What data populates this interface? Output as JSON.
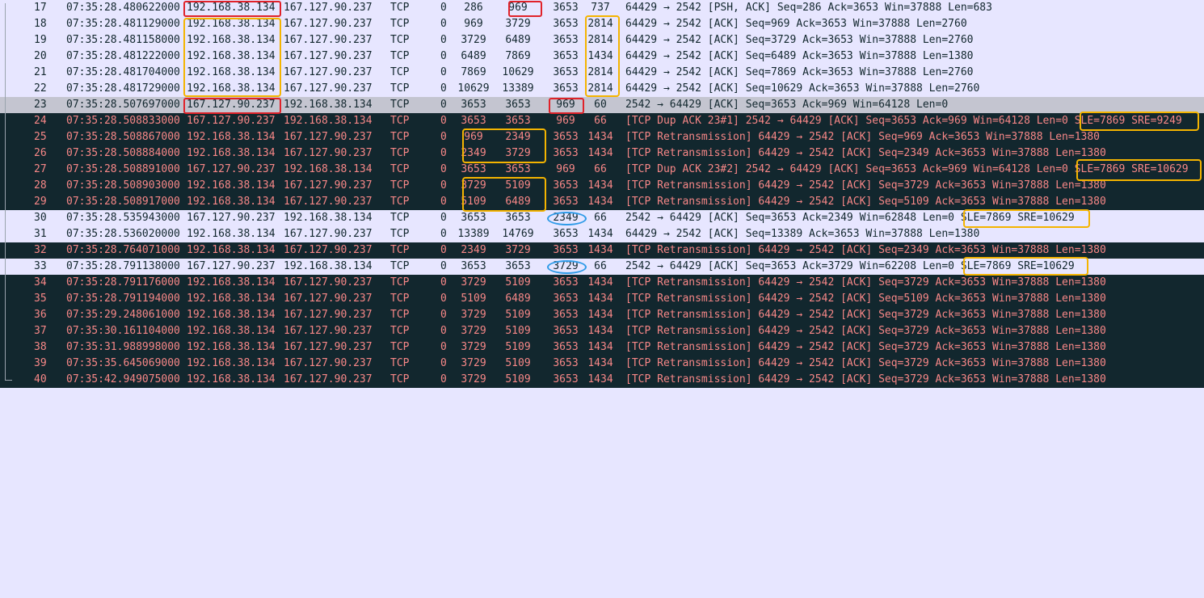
{
  "packets": [
    {
      "no": "17",
      "time": "07:35:28.480622000",
      "src": "192.168.38.134",
      "dst": "167.127.90.237",
      "proto": "TCP",
      "z": "0",
      "seq": "286",
      "nseq": "969",
      "ack": "3653",
      "len": "737",
      "info": "64429 → 2542 [PSH, ACK] Seq=286 Ack=3653 Win=37888 Len=683",
      "style": "tcp"
    },
    {
      "no": "18",
      "time": "07:35:28.481129000",
      "src": "192.168.38.134",
      "dst": "167.127.90.237",
      "proto": "TCP",
      "z": "0",
      "seq": "969",
      "nseq": "3729",
      "ack": "3653",
      "len": "2814",
      "info": "64429 → 2542 [ACK] Seq=969 Ack=3653 Win=37888 Len=2760",
      "style": "tcp"
    },
    {
      "no": "19",
      "time": "07:35:28.481158000",
      "src": "192.168.38.134",
      "dst": "167.127.90.237",
      "proto": "TCP",
      "z": "0",
      "seq": "3729",
      "nseq": "6489",
      "ack": "3653",
      "len": "2814",
      "info": "64429 → 2542 [ACK] Seq=3729 Ack=3653 Win=37888 Len=2760",
      "style": "tcp"
    },
    {
      "no": "20",
      "time": "07:35:28.481222000",
      "src": "192.168.38.134",
      "dst": "167.127.90.237",
      "proto": "TCP",
      "z": "0",
      "seq": "6489",
      "nseq": "7869",
      "ack": "3653",
      "len": "1434",
      "info": "64429 → 2542 [ACK] Seq=6489 Ack=3653 Win=37888 Len=1380",
      "style": "tcp"
    },
    {
      "no": "21",
      "time": "07:35:28.481704000",
      "src": "192.168.38.134",
      "dst": "167.127.90.237",
      "proto": "TCP",
      "z": "0",
      "seq": "7869",
      "nseq": "10629",
      "ack": "3653",
      "len": "2814",
      "info": "64429 → 2542 [ACK] Seq=7869 Ack=3653 Win=37888 Len=2760",
      "style": "tcp"
    },
    {
      "no": "22",
      "time": "07:35:28.481729000",
      "src": "192.168.38.134",
      "dst": "167.127.90.237",
      "proto": "TCP",
      "z": "0",
      "seq": "10629",
      "nseq": "13389",
      "ack": "3653",
      "len": "2814",
      "info": "64429 → 2542 [ACK] Seq=10629 Ack=3653 Win=37888 Len=2760",
      "style": "tcp"
    },
    {
      "no": "23",
      "time": "07:35:28.507697000",
      "src": "167.127.90.237",
      "dst": "192.168.38.134",
      "proto": "TCP",
      "z": "0",
      "seq": "3653",
      "nseq": "3653",
      "ack": "969",
      "len": "60",
      "info": "2542 → 64429 [ACK] Seq=3653 Ack=969 Win=64128 Len=0",
      "style": "sel"
    },
    {
      "no": "24",
      "time": "07:35:28.508833000",
      "src": "167.127.90.237",
      "dst": "192.168.38.134",
      "proto": "TCP",
      "z": "0",
      "seq": "3653",
      "nseq": "3653",
      "ack": "969",
      "len": "66",
      "info": "[TCP Dup ACK 23#1] 2542 → 64429 [ACK] Seq=3653 Ack=969 Win=64128 Len=0 SLE=7869 SRE=9249",
      "style": "bad"
    },
    {
      "no": "25",
      "time": "07:35:28.508867000",
      "src": "192.168.38.134",
      "dst": "167.127.90.237",
      "proto": "TCP",
      "z": "0",
      "seq": "969",
      "nseq": "2349",
      "ack": "3653",
      "len": "1434",
      "info": "[TCP Retransmission] 64429 → 2542 [ACK] Seq=969 Ack=3653 Win=37888 Len=1380",
      "style": "bad"
    },
    {
      "no": "26",
      "time": "07:35:28.508884000",
      "src": "192.168.38.134",
      "dst": "167.127.90.237",
      "proto": "TCP",
      "z": "0",
      "seq": "2349",
      "nseq": "3729",
      "ack": "3653",
      "len": "1434",
      "info": "[TCP Retransmission] 64429 → 2542 [ACK] Seq=2349 Ack=3653 Win=37888 Len=1380",
      "style": "bad"
    },
    {
      "no": "27",
      "time": "07:35:28.508891000",
      "src": "167.127.90.237",
      "dst": "192.168.38.134",
      "proto": "TCP",
      "z": "0",
      "seq": "3653",
      "nseq": "3653",
      "ack": "969",
      "len": "66",
      "info": "[TCP Dup ACK 23#2] 2542 → 64429 [ACK] Seq=3653 Ack=969 Win=64128 Len=0 SLE=7869 SRE=10629",
      "style": "bad"
    },
    {
      "no": "28",
      "time": "07:35:28.508903000",
      "src": "192.168.38.134",
      "dst": "167.127.90.237",
      "proto": "TCP",
      "z": "0",
      "seq": "3729",
      "nseq": "5109",
      "ack": "3653",
      "len": "1434",
      "info": "[TCP Retransmission] 64429 → 2542 [ACK] Seq=3729 Ack=3653 Win=37888 Len=1380",
      "style": "bad"
    },
    {
      "no": "29",
      "time": "07:35:28.508917000",
      "src": "192.168.38.134",
      "dst": "167.127.90.237",
      "proto": "TCP",
      "z": "0",
      "seq": "5109",
      "nseq": "6489",
      "ack": "3653",
      "len": "1434",
      "info": "[TCP Retransmission] 64429 → 2542 [ACK] Seq=5109 Ack=3653 Win=37888 Len=1380",
      "style": "bad"
    },
    {
      "no": "30",
      "time": "07:35:28.535943000",
      "src": "167.127.90.237",
      "dst": "192.168.38.134",
      "proto": "TCP",
      "z": "0",
      "seq": "3653",
      "nseq": "3653",
      "ack": "2349",
      "len": "66",
      "info": "2542 → 64429 [ACK] Seq=3653 Ack=2349 Win=62848 Len=0 SLE=7869 SRE=10629",
      "style": "tcp"
    },
    {
      "no": "31",
      "time": "07:35:28.536020000",
      "src": "192.168.38.134",
      "dst": "167.127.90.237",
      "proto": "TCP",
      "z": "0",
      "seq": "13389",
      "nseq": "14769",
      "ack": "3653",
      "len": "1434",
      "info": "64429 → 2542 [ACK] Seq=13389 Ack=3653 Win=37888 Len=1380",
      "style": "tcp"
    },
    {
      "no": "32",
      "time": "07:35:28.764071000",
      "src": "192.168.38.134",
      "dst": "167.127.90.237",
      "proto": "TCP",
      "z": "0",
      "seq": "2349",
      "nseq": "3729",
      "ack": "3653",
      "len": "1434",
      "info": "[TCP Retransmission] 64429 → 2542 [ACK] Seq=2349 Ack=3653 Win=37888 Len=1380",
      "style": "bad"
    },
    {
      "no": "33",
      "time": "07:35:28.791138000",
      "src": "167.127.90.237",
      "dst": "192.168.38.134",
      "proto": "TCP",
      "z": "0",
      "seq": "3653",
      "nseq": "3653",
      "ack": "3729",
      "len": "66",
      "info": "2542 → 64429 [ACK] Seq=3653 Ack=3729 Win=62208 Len=0 SLE=7869 SRE=10629",
      "style": "tcp"
    },
    {
      "no": "34",
      "time": "07:35:28.791176000",
      "src": "192.168.38.134",
      "dst": "167.127.90.237",
      "proto": "TCP",
      "z": "0",
      "seq": "3729",
      "nseq": "5109",
      "ack": "3653",
      "len": "1434",
      "info": "[TCP Retransmission] 64429 → 2542 [ACK] Seq=3729 Ack=3653 Win=37888 Len=1380",
      "style": "bad"
    },
    {
      "no": "35",
      "time": "07:35:28.791194000",
      "src": "192.168.38.134",
      "dst": "167.127.90.237",
      "proto": "TCP",
      "z": "0",
      "seq": "5109",
      "nseq": "6489",
      "ack": "3653",
      "len": "1434",
      "info": "[TCP Retransmission] 64429 → 2542 [ACK] Seq=5109 Ack=3653 Win=37888 Len=1380",
      "style": "bad"
    },
    {
      "no": "36",
      "time": "07:35:29.248061000",
      "src": "192.168.38.134",
      "dst": "167.127.90.237",
      "proto": "TCP",
      "z": "0",
      "seq": "3729",
      "nseq": "5109",
      "ack": "3653",
      "len": "1434",
      "info": "[TCP Retransmission] 64429 → 2542 [ACK] Seq=3729 Ack=3653 Win=37888 Len=1380",
      "style": "bad"
    },
    {
      "no": "37",
      "time": "07:35:30.161104000",
      "src": "192.168.38.134",
      "dst": "167.127.90.237",
      "proto": "TCP",
      "z": "0",
      "seq": "3729",
      "nseq": "5109",
      "ack": "3653",
      "len": "1434",
      "info": "[TCP Retransmission] 64429 → 2542 [ACK] Seq=3729 Ack=3653 Win=37888 Len=1380",
      "style": "bad"
    },
    {
      "no": "38",
      "time": "07:35:31.988998000",
      "src": "192.168.38.134",
      "dst": "167.127.90.237",
      "proto": "TCP",
      "z": "0",
      "seq": "3729",
      "nseq": "5109",
      "ack": "3653",
      "len": "1434",
      "info": "[TCP Retransmission] 64429 → 2542 [ACK] Seq=3729 Ack=3653 Win=37888 Len=1380",
      "style": "bad"
    },
    {
      "no": "39",
      "time": "07:35:35.645069000",
      "src": "192.168.38.134",
      "dst": "167.127.90.237",
      "proto": "TCP",
      "z": "0",
      "seq": "3729",
      "nseq": "5109",
      "ack": "3653",
      "len": "1434",
      "info": "[TCP Retransmission] 64429 → 2542 [ACK] Seq=3729 Ack=3653 Win=37888 Len=1380",
      "style": "bad"
    },
    {
      "no": "40",
      "time": "07:35:42.949075000",
      "src": "192.168.38.134",
      "dst": "167.127.90.237",
      "proto": "TCP",
      "z": "0",
      "seq": "3729",
      "nseq": "5109",
      "ack": "3653",
      "len": "1434",
      "info": "[TCP Retransmission] 64429 → 2542 [ACK] Seq=3729 Ack=3653 Win=37888 Len=1380",
      "style": "bad"
    }
  ],
  "colors": {
    "tcp_row_bg": "#e7e6ff",
    "selected_row_bg": "#c4c5d0",
    "bad_tcp_bg": "#12272e",
    "bad_tcp_fg": "#f78787",
    "annotation_red": "#e0222a",
    "annotation_orange": "#f4b400",
    "annotation_blue": "#2f9be8"
  }
}
